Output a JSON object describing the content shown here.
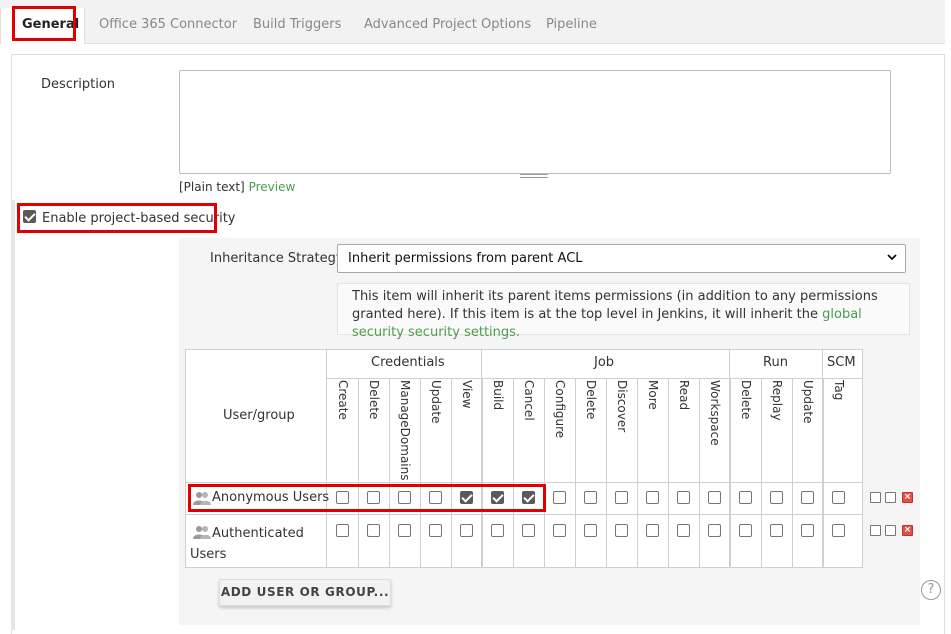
{
  "tabs": [
    {
      "label": "General",
      "active": true
    },
    {
      "label": "Office 365 Connector",
      "active": false
    },
    {
      "label": "Build Triggers",
      "active": false
    },
    {
      "label": "Advanced Project Options",
      "active": false
    },
    {
      "label": "Pipeline",
      "active": false
    }
  ],
  "description": {
    "label": "Description",
    "value": "",
    "plain_text": "[Plain text]",
    "preview_link": "Preview"
  },
  "security": {
    "enable_label": "Enable project-based security",
    "enabled": true
  },
  "inheritance": {
    "label": "Inheritance Strategy",
    "selected": "Inherit permissions from parent ACL",
    "help_text": "This item will inherit its parent items permissions (in addition to any permissions granted here). If this item is at the top level in Jenkins, it will inherit the ",
    "help_link": "global security security settings."
  },
  "matrix": {
    "user_header": "User/group",
    "groups": [
      "Credentials",
      "Job",
      "Run",
      "SCM"
    ],
    "permissions": [
      "Create",
      "Delete",
      "ManageDomains",
      "Update",
      "View",
      "Build",
      "Cancel",
      "Configure",
      "Delete",
      "Discover",
      "More",
      "Read",
      "Workspace",
      "Delete",
      "Replay",
      "Update",
      "Tag"
    ],
    "rows": [
      {
        "name": "Anonymous Users",
        "checked": [
          false,
          false,
          false,
          false,
          true,
          true,
          true,
          false,
          false,
          false,
          false,
          false,
          false,
          false,
          false,
          false,
          false
        ]
      },
      {
        "name": "Authenticated Users",
        "checked": [
          false,
          false,
          false,
          false,
          false,
          false,
          false,
          false,
          false,
          false,
          false,
          false,
          false,
          false,
          false,
          false,
          false
        ]
      }
    ]
  },
  "add_button": "ADD USER OR GROUP...",
  "help_icon": "?",
  "icons": {
    "user_group": "users-icon",
    "toggle_all": "check-all-icon",
    "uncheck_all": "uncheck-all-icon",
    "remove": "remove-icon"
  },
  "colors": {
    "highlight": "#e00000",
    "link": "#4a9c4a",
    "remove": "#d9534f"
  }
}
